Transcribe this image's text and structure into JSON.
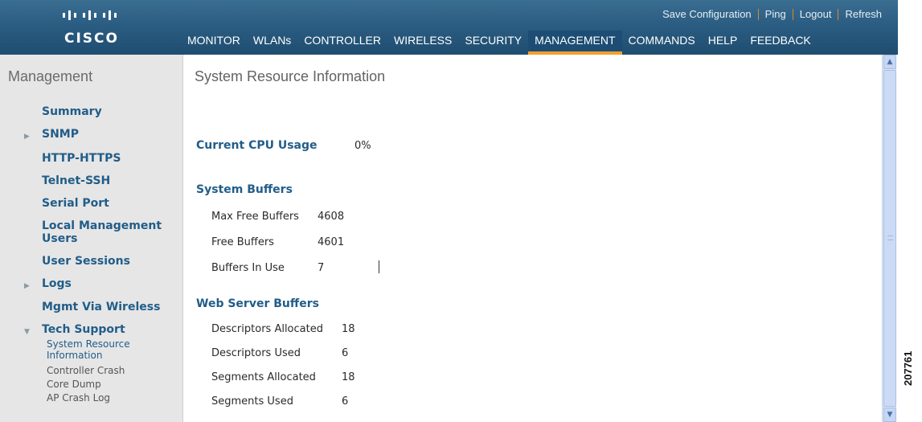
{
  "logo": {
    "text": "CISCO"
  },
  "top_links": {
    "save": "Save Configuration",
    "ping": "Ping",
    "logout": "Logout",
    "refresh": "Refresh"
  },
  "nav": {
    "items": [
      {
        "label": "MONITOR",
        "active": false
      },
      {
        "label": "WLANs",
        "active": false
      },
      {
        "label": "CONTROLLER",
        "active": false
      },
      {
        "label": "WIRELESS",
        "active": false
      },
      {
        "label": "SECURITY",
        "active": false
      },
      {
        "label": "MANAGEMENT",
        "active": true
      },
      {
        "label": "COMMANDS",
        "active": false
      },
      {
        "label": "HELP",
        "active": false
      },
      {
        "label": "FEEDBACK",
        "active": false
      }
    ]
  },
  "sidebar": {
    "title": "Management",
    "items": [
      {
        "label": "Summary"
      },
      {
        "label": "SNMP",
        "icon": "expand-right-triangle"
      },
      {
        "label": "HTTP-HTTPS"
      },
      {
        "label": "Telnet-SSH"
      },
      {
        "label": "Serial Port"
      },
      {
        "label": "Local Management Users"
      },
      {
        "label": "User Sessions"
      },
      {
        "label": "Logs",
        "icon": "expand-right-triangle"
      },
      {
        "label": "Mgmt Via Wireless"
      },
      {
        "label": "Tech Support",
        "icon": "expand-down-triangle"
      }
    ],
    "sub_items": [
      {
        "label": "System Resource Information",
        "active": true
      },
      {
        "label": "Controller Crash"
      },
      {
        "label": "Core Dump"
      },
      {
        "label": "AP Crash Log"
      }
    ]
  },
  "main": {
    "title": "System Resource Information",
    "cpu": {
      "label": "Current CPU Usage",
      "value": "0%"
    },
    "system_buffers": {
      "heading": "System Buffers",
      "rows": [
        {
          "label": "Max Free Buffers",
          "value": "4608"
        },
        {
          "label": "Free Buffers",
          "value": "4601"
        },
        {
          "label": "Buffers In Use",
          "value": "7"
        }
      ]
    },
    "web_server_buffers": {
      "heading": "Web Server Buffers",
      "rows": [
        {
          "label": "Descriptors Allocated",
          "value": "18"
        },
        {
          "label": "Descriptors Used",
          "value": "6"
        },
        {
          "label": "Segments Allocated",
          "value": "18"
        },
        {
          "label": "Segments Used",
          "value": "6"
        }
      ]
    }
  },
  "figure_id": "207761",
  "colors": {
    "header": "#2b5d82",
    "accent": "#f0a030",
    "link": "#215d89",
    "sidebar_bg": "#e6e6e6"
  }
}
